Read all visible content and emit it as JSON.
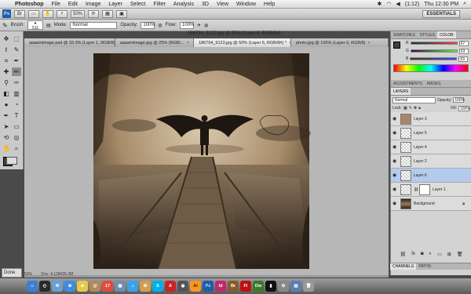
{
  "menubar": {
    "app": "Photoshop",
    "items": [
      "File",
      "Edit",
      "Image",
      "Layer",
      "Select",
      "Filter",
      "Analysis",
      "3D",
      "View",
      "Window",
      "Help"
    ],
    "battery": "(1:12)",
    "clock": "Thu 12:30 PM"
  },
  "appbar": {
    "logo": "Ps",
    "zoom": "50%",
    "workspace": "ESSENTIALS"
  },
  "options": {
    "brush_label": "Brush:",
    "brush_size": "511",
    "mode_label": "Mode:",
    "mode_value": "Normal",
    "opacity_label": "Opacity:",
    "opacity_value": "100%",
    "flow_label": "Flow:",
    "flow_value": "100%"
  },
  "document": {
    "title": "186794_9123.jpg @ 50% (Layer 6, RGB/8#) *",
    "tabs": [
      {
        "label": "aaaamimage.psd @ 33.3% (Layer 1, RGB/8)"
      },
      {
        "label": "aaaamimage.jpg @ 25% (RGB/..."
      },
      {
        "label": "186794_9123.jpg @ 50% (Layer 6, RGB/8#) *"
      },
      {
        "label": "photo.jpg @ 100% (Layer 0, RGB/8)"
      }
    ],
    "status_zoom": "50%",
    "status_text": "Doc: 4.12M/35.2M"
  },
  "panels": {
    "color_tabs": [
      "SWATCHES",
      "STYLES",
      "COLOR"
    ],
    "color": {
      "r_label": "R",
      "r_value": "67",
      "g_label": "G",
      "g_value": "63",
      "b_label": "B",
      "b_value": "63"
    },
    "adjust_tabs": [
      "ADJUSTMENTS",
      "MASKS"
    ],
    "layers_tab": "LAYERS",
    "blend_mode": "Normal",
    "opacity_label": "Opacity:",
    "opacity_value": "100%",
    "lock_label": "Lock:",
    "fill_label": "Fill:",
    "fill_value": "100%",
    "layers": [
      {
        "name": "Layer 3",
        "thumb": "tan",
        "selected": false
      },
      {
        "name": "Layer 5",
        "thumb": "trans",
        "selected": false
      },
      {
        "name": "Layer 4",
        "thumb": "trans",
        "selected": false
      },
      {
        "name": "Layer 2",
        "thumb": "trans",
        "selected": false
      },
      {
        "name": "Layer 6",
        "thumb": "trans",
        "selected": true
      },
      {
        "name": "Layer 1",
        "thumb": "white",
        "selected": false
      },
      {
        "name": "Background",
        "thumb": "photo",
        "selected": false
      }
    ],
    "bottom_tabs": [
      "CHANNELS",
      "PATHS"
    ]
  },
  "done_label": "Done",
  "dock": [
    "Finder",
    "Dashboard",
    "Mail",
    "Safari",
    "iChat",
    "Address",
    "iCal",
    "Preview",
    "iTunes",
    "iPhoto",
    "Skype",
    "Acrobat",
    "Photos",
    "Ai",
    "Ps",
    "Id",
    "Br",
    "Fl",
    "Dw",
    "Terminal",
    "Prefs",
    "App",
    "Trash"
  ],
  "colors": {
    "accent": "#1c5fa8",
    "sepia_dark": "#2b2016",
    "sepia_light": "#c9b69a",
    "selected_layer": "#b3cbec"
  }
}
